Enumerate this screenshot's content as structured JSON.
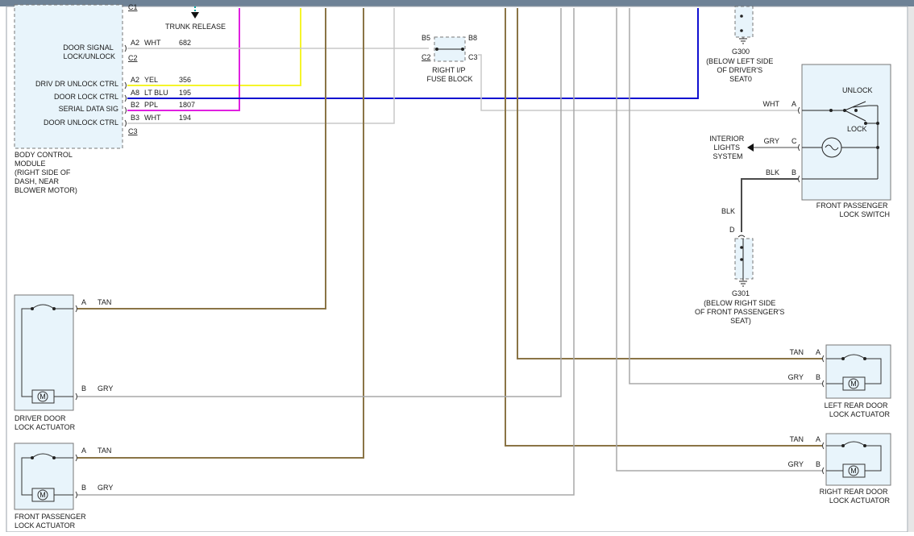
{
  "colors": {
    "tan": "#8a7446",
    "white": "#c8c8c8",
    "gray": "#a8a8a8",
    "yellow": "#f5f52a",
    "blue": "#1010d0",
    "pink": "#e020e0",
    "black": "#4a4a4a",
    "component_fill": "#e8f4fb",
    "top_bar": "#6e8296"
  },
  "bcm": {
    "connector_top": "C1",
    "signal_label": "DOOR SIGNAL\nLOCK/UNLOCK",
    "signal_pin": "A2",
    "signal_color": "WHT",
    "signal_circuit": "682",
    "connector_mid": "C2",
    "pins": [
      {
        "label": "DRIV DR UNLOCK CTRL",
        "pin": "A2",
        "color": "YEL",
        "circuit": "356"
      },
      {
        "label": "DOOR LOCK CTRL",
        "pin": "A8",
        "color": "LT BLU",
        "circuit": "195"
      },
      {
        "label": "SERIAL DATA SIG",
        "pin": "B2",
        "color": "PPL",
        "circuit": "1807"
      },
      {
        "label": "DOOR UNLOCK CTRL",
        "pin": "B3",
        "color": "WHT",
        "circuit": "194"
      }
    ],
    "connector_bottom": "C3",
    "name": "BODY CONTROL\nMODULE\n(RIGHT SIDE OF\nDASH, NEAR\nBLOWER MOTOR)"
  },
  "trunk_release": "TRUNK RELEASE",
  "fuse_block": {
    "pins": [
      "B5",
      "B8",
      "C2",
      "C3"
    ],
    "name": "RIGHT I/P\nFUSE BLOCK"
  },
  "g300": {
    "id": "G300",
    "location": "(BELOW LEFT SIDE\nOF DRIVER'S\nSEAT0"
  },
  "lock_switch": {
    "pin_a": "A",
    "pin_a_color": "WHT",
    "pin_c": "C",
    "pin_c_color": "GRY",
    "pin_b": "B",
    "pin_b_color": "BLK",
    "unlock": "UNLOCK",
    "lock": "LOCK",
    "name": "FRONT PASSENGER\nLOCK SWITCH"
  },
  "interior_lights": "INTERIOR\nLIGHTS\nSYSTEM",
  "g301": {
    "wire_color": "BLK",
    "pin": "D",
    "id": "G301",
    "location": "(BELOW RIGHT SIDE\nOF FRONT PASSENGER'S\nSEAT)"
  },
  "actuators": [
    {
      "key": "driver",
      "name": "DRIVER DOOR\nLOCK ACTUATOR",
      "pin_a": "A",
      "color_a": "TAN",
      "pin_b": "B",
      "color_b": "GRY"
    },
    {
      "key": "front_pass",
      "name": "FRONT PASSENGER\nLOCK ACTUATOR",
      "pin_a": "A",
      "color_a": "TAN",
      "pin_b": "B",
      "color_b": "GRY"
    },
    {
      "key": "left_rear",
      "name": "LEFT REAR DOOR\nLOCK ACTUATOR",
      "pin_a": "A",
      "color_a": "TAN",
      "pin_b": "B",
      "color_b": "GRY"
    },
    {
      "key": "right_rear",
      "name": "RIGHT REAR DOOR\nLOCK ACTUATOR",
      "pin_a": "A",
      "color_a": "TAN",
      "pin_b": "B",
      "color_b": "GRY"
    }
  ],
  "motor_symbol": "M"
}
